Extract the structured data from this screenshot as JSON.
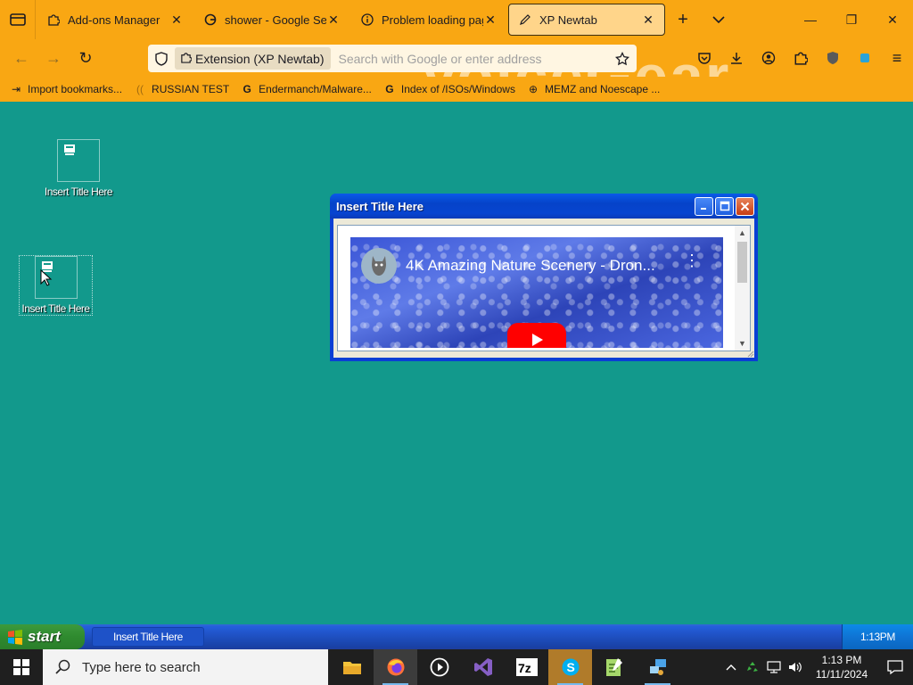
{
  "browser": {
    "tabs": [
      {
        "title": "Add-ons Manager",
        "icon": "puzzle-icon",
        "selected": false
      },
      {
        "title": "shower - Google Search",
        "icon": "google-icon",
        "selected": false
      },
      {
        "title": "Problem loading page",
        "icon": "info-icon",
        "selected": false
      },
      {
        "title": "XP Newtab",
        "icon": "pencil-icon",
        "selected": true
      }
    ],
    "url_identity": "Extension (XP Newtab)",
    "url_placeholder": "Search with Google or enter address",
    "brand_watermark": "VoiceGear",
    "bookmarks": [
      {
        "label": "Import bookmarks...",
        "icon": "import-icon"
      },
      {
        "label": "RUSSIAN TEST",
        "icon": "loading-icon"
      },
      {
        "label": "Endermanch/Malware...",
        "icon": "google-icon"
      },
      {
        "label": "Index of /ISOs/Windows",
        "icon": "google-icon"
      },
      {
        "label": "MEMZ and Noescape ...",
        "icon": "globe-icon"
      }
    ],
    "theme_color": "#f9a713"
  },
  "desktop": {
    "background": "#12998c",
    "icons": [
      {
        "label": "Insert Title Here"
      },
      {
        "label": "Insert Title Here"
      }
    ],
    "window": {
      "title": "Insert Title Here",
      "video_title": "4K Amazing Nature Scenery - Dron..."
    }
  },
  "xp_taskbar": {
    "start_label": "start",
    "task_label": "Insert Title Here",
    "clock": "1:13PM"
  },
  "win_taskbar": {
    "search_placeholder": "Type here to search",
    "time": "1:13 PM",
    "date": "11/11/2024",
    "apps": [
      "file-explorer-icon",
      "firefox-icon",
      "media-player-icon",
      "visual-studio-icon",
      "7zip-icon",
      "skype-icon",
      "notepad-icon",
      "network-app-icon"
    ]
  }
}
